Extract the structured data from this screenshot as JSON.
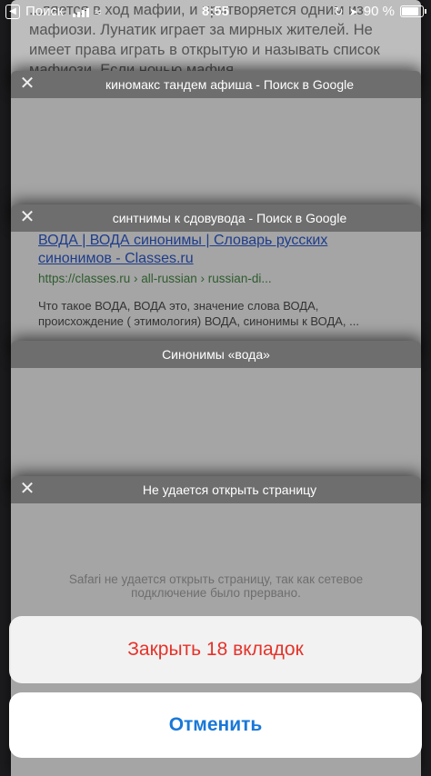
{
  "status_bar": {
    "back_app": "Поиск",
    "time": "8:55",
    "battery_text": "90 %",
    "battery_level": 0.9
  },
  "background_text": "...ляется в ход мафии, и притворяется одним из мафиози. Лунатик играет за мирных жителей. Не имеет права играть в открытую и называть список мафиози. Если ночью мафия",
  "tabs": [
    {
      "title": "киномакс тандем афиша - Поиск в Google"
    },
    {
      "title": "синтнимы к сдовувода - Поиск в Google",
      "result_title": "ВОДА | ВОДА синонимы | Словарь русских синонимов - Classes.ru",
      "result_url": "https://classes.ru › all-russian › russian-di...",
      "result_snippet": "Что такое ВОДА, ВОДА это, значение слова ВОДА, происхождение ( этимология) ВОДА, синонимы к ВОДА, ..."
    },
    {
      "title": "Синонимы «вода»"
    },
    {
      "title": "Не удается открыть страницу",
      "error_text": "Safari не удается открыть страницу, так как сетевое подключение было прервано."
    }
  ],
  "actions": {
    "close_all": "Закрыть 18 вкладок",
    "cancel": "Отменить"
  },
  "colors": {
    "destructive": "#e5332a",
    "accent": "#1978d8"
  }
}
